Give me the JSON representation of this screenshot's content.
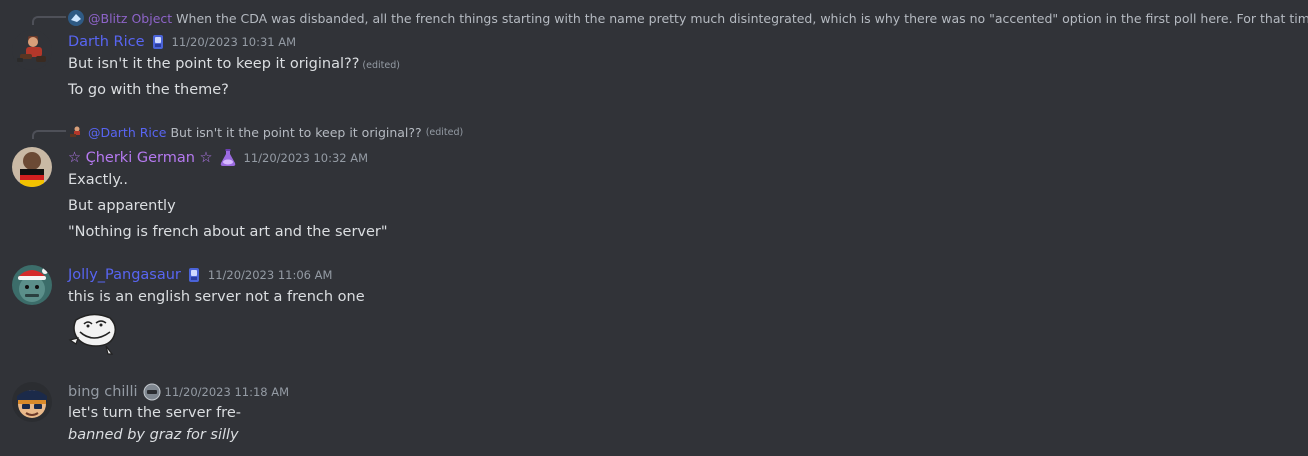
{
  "messages": [
    {
      "reply": {
        "username": "@Blitz Object",
        "text": "When the CDA was disbanded, all the french things starting with the name pretty much disintegrated, which is why there was no \"accented\" option in the first poll here. For that time period,",
        "edited": ""
      },
      "author": {
        "name": "Darth Rice",
        "color": "#5865f2",
        "timestamp": "11/20/2023 10:31 AM",
        "role_icon": "blue-flask-icon"
      },
      "lines": [
        {
          "text": "But isn't it the point to keep it original??",
          "edited": "(edited)"
        },
        {
          "text": "To go with the theme?",
          "edited": ""
        }
      ]
    },
    {
      "reply": {
        "username": "@Darth Rice",
        "text": "But isn't it the point to keep it original??",
        "edited": "(edited)"
      },
      "author": {
        "name": "☆ Çherki German ☆",
        "color": "#b579f0",
        "timestamp": "11/20/2023 10:32 AM",
        "role_icon": "purple-potion-icon"
      },
      "lines": [
        {
          "text": "Exactly..",
          "edited": ""
        },
        {
          "text": "But apparently",
          "edited": ""
        },
        {
          "text": "\"Nothing is french about art and the server\"",
          "edited": ""
        }
      ]
    },
    {
      "author": {
        "name": "Jolly_Pangasaur",
        "color": "#5865f2",
        "timestamp": "11/20/2023 11:06 AM",
        "role_icon": "blue-flask-icon"
      },
      "lines": [
        {
          "text": "this is an english server not a french one",
          "edited": ""
        }
      ],
      "sticker": "trollface-sticker"
    },
    {
      "author": {
        "name": "bing chilli",
        "color": "#949ba4",
        "timestamp": "11/20/2023 11:18 AM",
        "role_icon": "grey-helmet-icon"
      },
      "lines": [
        {
          "text": "let's turn the server fre-",
          "edited": ""
        },
        {
          "text": "banned by graz for silly",
          "edited": ""
        }
      ]
    }
  ]
}
